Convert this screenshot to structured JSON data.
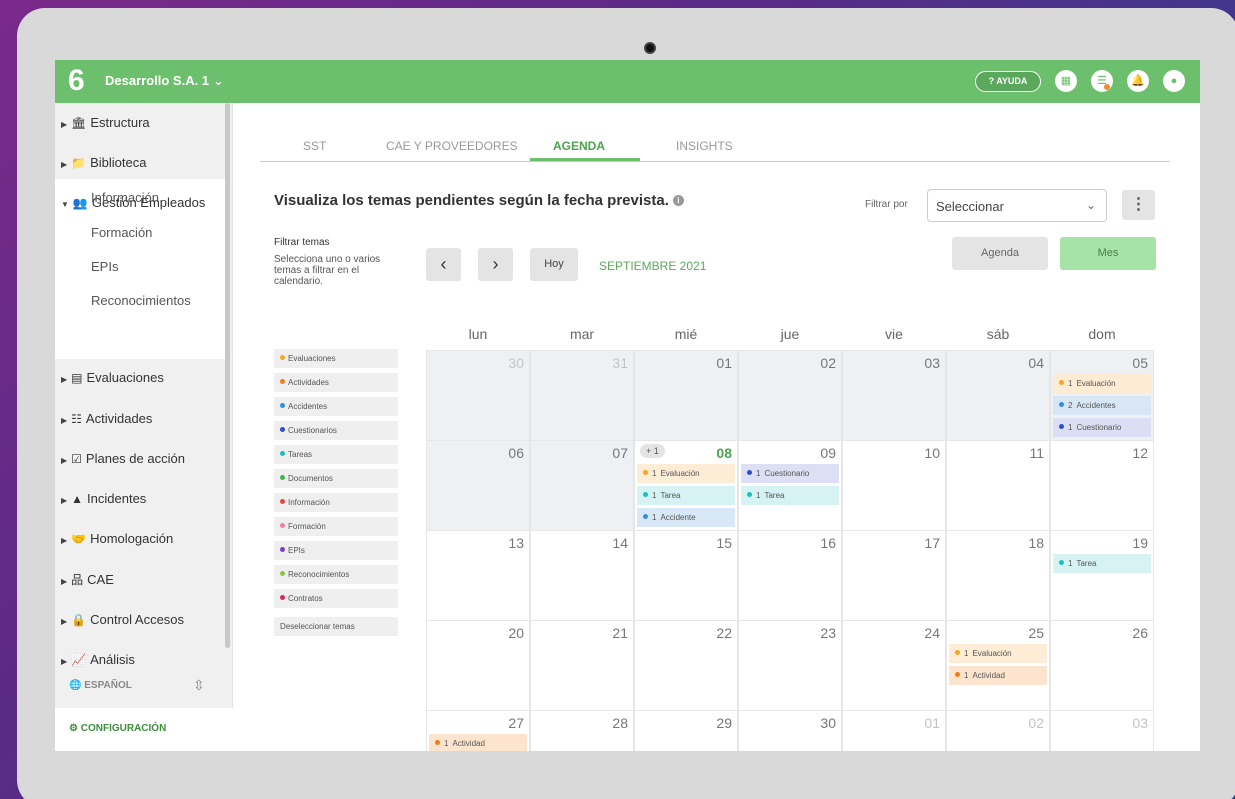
{
  "header": {
    "logo": "6",
    "company": "Desarrollo S.A. 1",
    "help_label": "? AYUDA"
  },
  "sidebar": {
    "items": [
      {
        "label": "Estructura",
        "icon": "building-icon"
      },
      {
        "label": "Biblioteca",
        "icon": "folder-icon"
      },
      {
        "label": "Gestión Empleados",
        "icon": "users-icon"
      },
      {
        "label": "Evaluaciones",
        "icon": "list-box-icon"
      },
      {
        "label": "Actividades",
        "icon": "list-icon"
      },
      {
        "label": "Planes de acción",
        "icon": "calendar-check-icon"
      },
      {
        "label": "Incidentes",
        "icon": "warning-icon"
      },
      {
        "label": "Homologación",
        "icon": "handshake-icon"
      },
      {
        "label": "CAE",
        "icon": "org-chart-icon"
      },
      {
        "label": "Control Accesos",
        "icon": "lock-icon"
      },
      {
        "label": "Análisis",
        "icon": "chart-icon"
      }
    ],
    "sub_items": [
      "Información",
      "Formación",
      "EPIs",
      "Reconocimientos"
    ],
    "language": "ESPAÑOL",
    "config": "CONFIGURACIÓN"
  },
  "tabs": [
    {
      "label": "SST"
    },
    {
      "label": "CAE Y PROVEEDORES"
    },
    {
      "label": "AGENDA"
    },
    {
      "label": "INSIGHTS"
    }
  ],
  "main": {
    "heading": "Visualiza los temas pendientes según la fecha prevista.",
    "filter_label": "Filtrar por",
    "filter_value": "Seleccionar",
    "filter_topics_title": "Filtrar temas",
    "filter_topics_desc": "Selecciona uno o varios temas a filtrar en el calendario.",
    "today": "Hoy",
    "month": "SEPTIEMBRE 2021",
    "view_agenda": "Agenda",
    "view_month": "Mes",
    "deselect": "Deseleccionar temas"
  },
  "topics": [
    {
      "label": "Evaluaciones",
      "color": "#f5a623"
    },
    {
      "label": "Actividades",
      "color": "#f07d1a"
    },
    {
      "label": "Accidentes",
      "color": "#2d8fdd"
    },
    {
      "label": "Cuestionarios",
      "color": "#2c4fc9"
    },
    {
      "label": "Tareas",
      "color": "#1bbfbf"
    },
    {
      "label": "Documentos",
      "color": "#3fb54a"
    },
    {
      "label": "Información",
      "color": "#e8453c"
    },
    {
      "label": "Formación",
      "color": "#f07fa8"
    },
    {
      "label": "EPIs",
      "color": "#7b3fc9"
    },
    {
      "label": "Reconocimientos",
      "color": "#8dc63f"
    },
    {
      "label": "Contratos",
      "color": "#e0246b"
    }
  ],
  "calendar": {
    "days_of_week": [
      "lun",
      "mar",
      "mié",
      "jue",
      "vie",
      "sáb",
      "dom"
    ],
    "weeks": [
      [
        "30",
        "31",
        "01",
        "02",
        "03",
        "04",
        "05"
      ],
      [
        "06",
        "07",
        "08",
        "09",
        "10",
        "11",
        "12"
      ],
      [
        "13",
        "14",
        "15",
        "16",
        "17",
        "18",
        "19"
      ],
      [
        "20",
        "21",
        "22",
        "23",
        "24",
        "25",
        "26"
      ],
      [
        "27",
        "28",
        "29",
        "30",
        "01",
        "02",
        "03"
      ]
    ],
    "more_badge": "+ 1",
    "events": {
      "0-6": [
        {
          "count": "1",
          "label": "Evaluación",
          "color": "#f5a623",
          "bg": "#fdebd3"
        },
        {
          "count": "2",
          "label": "Accidentes",
          "color": "#2d8fdd",
          "bg": "#d8e7f6"
        },
        {
          "count": "1",
          "label": "Cuestionario",
          "color": "#2c4fc9",
          "bg": "#dcdff3"
        }
      ],
      "1-2": [
        {
          "count": "1",
          "label": "Evaluación",
          "color": "#f5a623",
          "bg": "#fdecd6"
        },
        {
          "count": "1",
          "label": "Tarea",
          "color": "#1bbfbf",
          "bg": "#d6f2f2"
        },
        {
          "count": "1",
          "label": "Accidente",
          "color": "#2d8fdd",
          "bg": "#d8e8f7"
        }
      ],
      "1-3": [
        {
          "count": "1",
          "label": "Cuestionario",
          "color": "#2c4fc9",
          "bg": "#dde0f4"
        },
        {
          "count": "1",
          "label": "Tarea",
          "color": "#1bbfbf",
          "bg": "#d6f2f2"
        }
      ],
      "2-6": [
        {
          "count": "1",
          "label": "Tarea",
          "color": "#1bbfbf",
          "bg": "#d6f2f2"
        }
      ],
      "3-5": [
        {
          "count": "1",
          "label": "Evaluación",
          "color": "#f5a623",
          "bg": "#fdecd6"
        },
        {
          "count": "1",
          "label": "Actividad",
          "color": "#f07d1a",
          "bg": "#fde4cf"
        }
      ],
      "4-0": [
        {
          "count": "1",
          "label": "Actividad",
          "color": "#f07d1a",
          "bg": "#fde4cf"
        }
      ]
    }
  },
  "colors": {
    "brand_green": "#6cbf6d",
    "active_tab": "#4ba44e"
  }
}
